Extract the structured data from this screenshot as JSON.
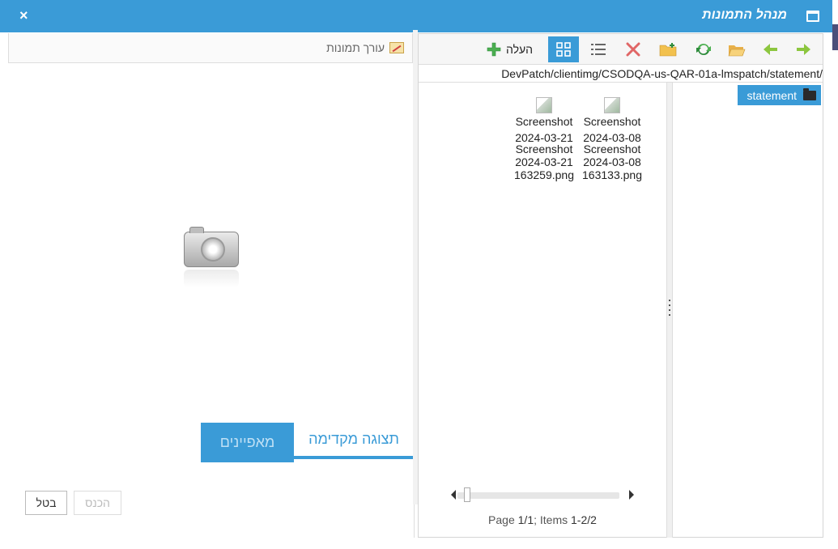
{
  "window": {
    "title": "מנהל התמונות",
    "close_label": "×"
  },
  "toolbar": {
    "upload_label": "העלה",
    "buttons": [
      "forward-icon",
      "back-icon",
      "open-folder-icon",
      "refresh-icon",
      "new-folder-icon",
      "delete-icon",
      "list-view-icon",
      "thumbnail-view-icon",
      "add-icon"
    ],
    "active_view": "thumbnails"
  },
  "path": "DevPatch/clientimg/CSODQA-us-QAR-01a-lmspatch/statement/",
  "tree": {
    "selected": "statement"
  },
  "files": [
    {
      "short": "Screenshot",
      "date": "2024-03-08",
      "full": "Screenshot 2024-03-08 163133.png"
    },
    {
      "short": "Screenshot",
      "date": "2024-03-21",
      "full": "Screenshot 2024-03-21 163259.png"
    }
  ],
  "pager": {
    "label_page": "Page",
    "page": "1/1",
    "label_items": "; Items",
    "items": "1-2/2"
  },
  "editor": {
    "label": "עורך תמונות"
  },
  "tabs": {
    "properties": "מאפיינים",
    "preview": "תצוגה מקדימה"
  },
  "buttons": {
    "cancel": "בטל",
    "insert": "הכנס"
  },
  "colors": {
    "accent": "#3a9bd7"
  }
}
